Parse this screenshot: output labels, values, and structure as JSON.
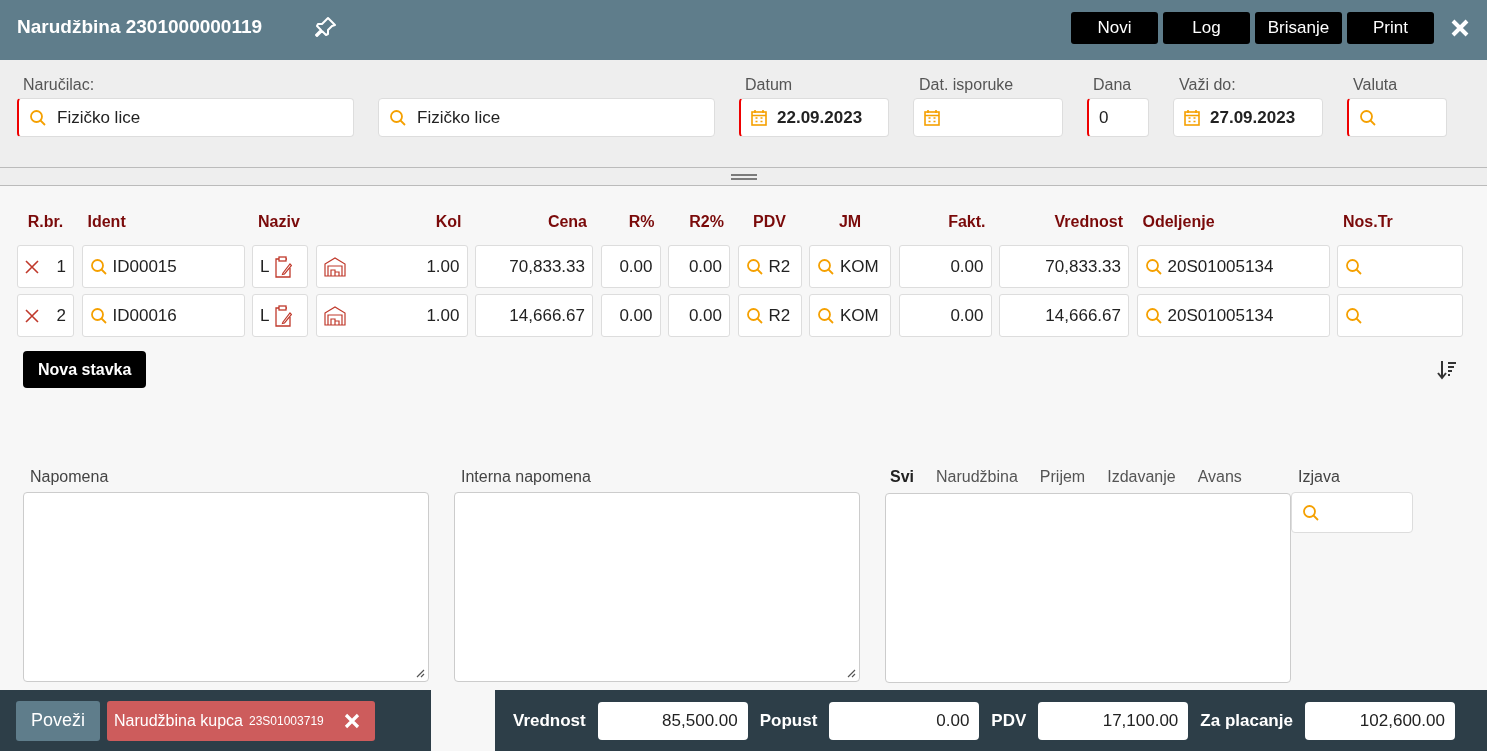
{
  "window": {
    "title": "Narudžbina 2301000000119",
    "buttons": [
      "Novi",
      "Log",
      "Brisanje",
      "Print"
    ]
  },
  "header_fields": [
    {
      "label": "Naručilac:",
      "kind": "search",
      "value": "Fizičko lice",
      "required": true
    },
    {
      "kind": "search",
      "value": "Fizičko lice",
      "required": false
    },
    {
      "label": "Datum",
      "kind": "date",
      "value": "22.09.2023",
      "required": true
    },
    {
      "label": "Dat. isporuke",
      "kind": "date",
      "required": false
    },
    {
      "label": "Dana",
      "kind": "text",
      "value": "0",
      "required": true
    },
    {
      "label": "Važi do:",
      "kind": "date",
      "value": "27.09.2023",
      "required": false
    },
    {
      "label": "Valuta",
      "kind": "search",
      "required": true
    }
  ],
  "table": {
    "columns": [
      "R.br.",
      "Ident",
      "Naziv",
      "Kol",
      "Cena",
      "R%",
      "R2%",
      "PDV",
      "JM",
      "Fakt.",
      "Vrednost",
      "Odeljenje",
      "Nos.Tr"
    ],
    "rows": [
      {
        "no": "1",
        "ident": "ID00015",
        "naziv": "L",
        "kol": "1.00",
        "cena": "70,833.33",
        "r": "0.00",
        "r2": "0.00",
        "pdv": "R2",
        "jm": "KOM",
        "fakt": "0.00",
        "vrednost": "70,833.33",
        "odeljenje": "20S01005134"
      },
      {
        "no": "2",
        "ident": "ID00016",
        "naziv": "L",
        "kol": "1.00",
        "cena": "14,666.67",
        "r": "0.00",
        "r2": "0.00",
        "pdv": "R2",
        "jm": "KOM",
        "fakt": "0.00",
        "vrednost": "14,666.67",
        "odeljenje": "20S01005134"
      }
    ],
    "add_button": "Nova stavka"
  },
  "notes": [
    {
      "label": "Napomena"
    },
    {
      "label": "Interna napomena"
    }
  ],
  "doc_tabs": [
    {
      "label": "Svi",
      "selected": true
    },
    {
      "label": "Narudžbina",
      "selected": false
    },
    {
      "label": "Prijem",
      "selected": false
    },
    {
      "label": "Izdavanje",
      "selected": false
    },
    {
      "label": "Avans",
      "selected": false
    }
  ],
  "izjava": {
    "label": "Izjava"
  },
  "footer": {
    "link_button": "Poveži",
    "linked": {
      "label": "Narudžbina kupca",
      "number": "23S01003719"
    },
    "totals": [
      {
        "label": "Vrednost",
        "value": "85,500.00"
      },
      {
        "label": "Popust",
        "value": "0.00"
      },
      {
        "label": "PDV",
        "value": "17,100.00"
      },
      {
        "label": "Za placanje",
        "value": "102,600.00"
      }
    ]
  }
}
